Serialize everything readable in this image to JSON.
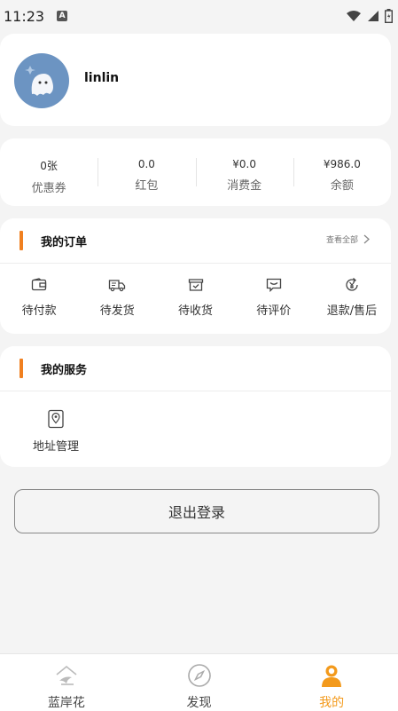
{
  "status_bar": {
    "time": "11:23",
    "badge": "A"
  },
  "profile": {
    "username": "linlin"
  },
  "wallet": [
    {
      "value": "0张",
      "label": "优惠券"
    },
    {
      "value": "0.0",
      "label": "红包"
    },
    {
      "value": "¥0.0",
      "label": "消费金"
    },
    {
      "value": "¥986.0",
      "label": "余额"
    }
  ],
  "orders": {
    "title": "我的订单",
    "view_all": "查看全部",
    "items": [
      {
        "label": "待付款",
        "icon": "wallet-icon"
      },
      {
        "label": "待发货",
        "icon": "truck-icon"
      },
      {
        "label": "待收货",
        "icon": "box-icon"
      },
      {
        "label": "待评价",
        "icon": "comment-icon"
      },
      {
        "label": "退款/售后",
        "icon": "refund-icon"
      }
    ]
  },
  "services": {
    "title": "我的服务",
    "items": [
      {
        "label": "地址管理",
        "icon": "location-icon"
      }
    ]
  },
  "logout_label": "退出登录",
  "tabbar": {
    "items": [
      {
        "label": "蓝岸花",
        "icon": "home-icon",
        "active": false
      },
      {
        "label": "发现",
        "icon": "compass-icon",
        "active": false
      },
      {
        "label": "我的",
        "icon": "user-icon",
        "active": true
      }
    ],
    "active_color": "#f39a1c"
  },
  "colors": {
    "accent": "#f08020",
    "avatar_bg": "#6c94c2"
  }
}
